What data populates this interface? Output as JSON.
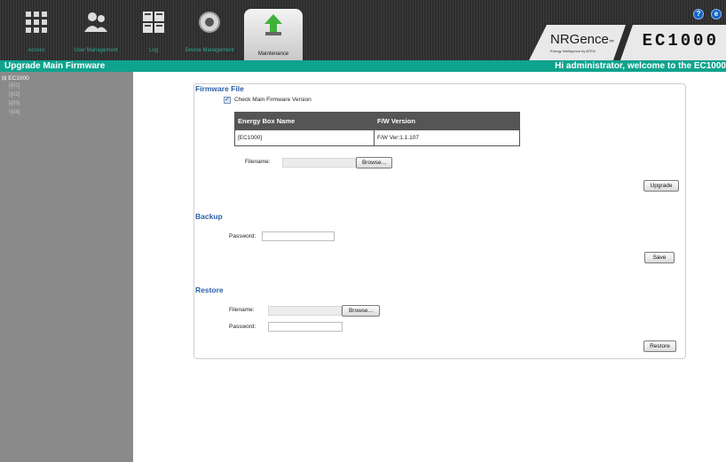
{
  "nav": [
    {
      "label": "Access",
      "icon": "access-grid-icon"
    },
    {
      "label": "User Management",
      "icon": "users-icon"
    },
    {
      "label": "Log",
      "icon": "log-icon"
    },
    {
      "label": "Device Management",
      "icon": "device-gear-icon"
    },
    {
      "label": "Maintenance",
      "icon": "maintenance-upload-icon"
    }
  ],
  "brand": {
    "logo": "NRGence",
    "tm": "™",
    "tagline": "Energy Intelligence by ATEN",
    "model": "EC1000"
  },
  "topicons": {
    "help": "?",
    "logout": "e"
  },
  "titlebar": {
    "left": "Upgrade Main Firmware",
    "right": "Hi administrator, welcome to the EC1000"
  },
  "sidebar": {
    "root": "EC1000",
    "items": [
      "[01]",
      "[02]",
      "[03]",
      "[04]"
    ]
  },
  "firmware": {
    "title": "Firmware File",
    "check_label": "Check Main Firmware Version",
    "check_mark": "✓",
    "table_headers": [
      "Energy Box Name",
      "F/W Version"
    ],
    "table_rows": [
      [
        "[EC1000]",
        "F/W Ver:1.1.107"
      ]
    ],
    "filename_label": "Filename:",
    "browse": "Browse...",
    "upgrade": "Upgrade"
  },
  "backup": {
    "title": "Backup",
    "password_label": "Password:",
    "save": "Save"
  },
  "restore": {
    "title": "Restore",
    "filename_label": "Filename:",
    "browse": "Browse...",
    "password_label": "Password:",
    "restore": "Restore"
  },
  "colors": {
    "accent": "#0fa38e",
    "section_title": "#2b5fa8",
    "sidebar": "#8a8a8a"
  }
}
